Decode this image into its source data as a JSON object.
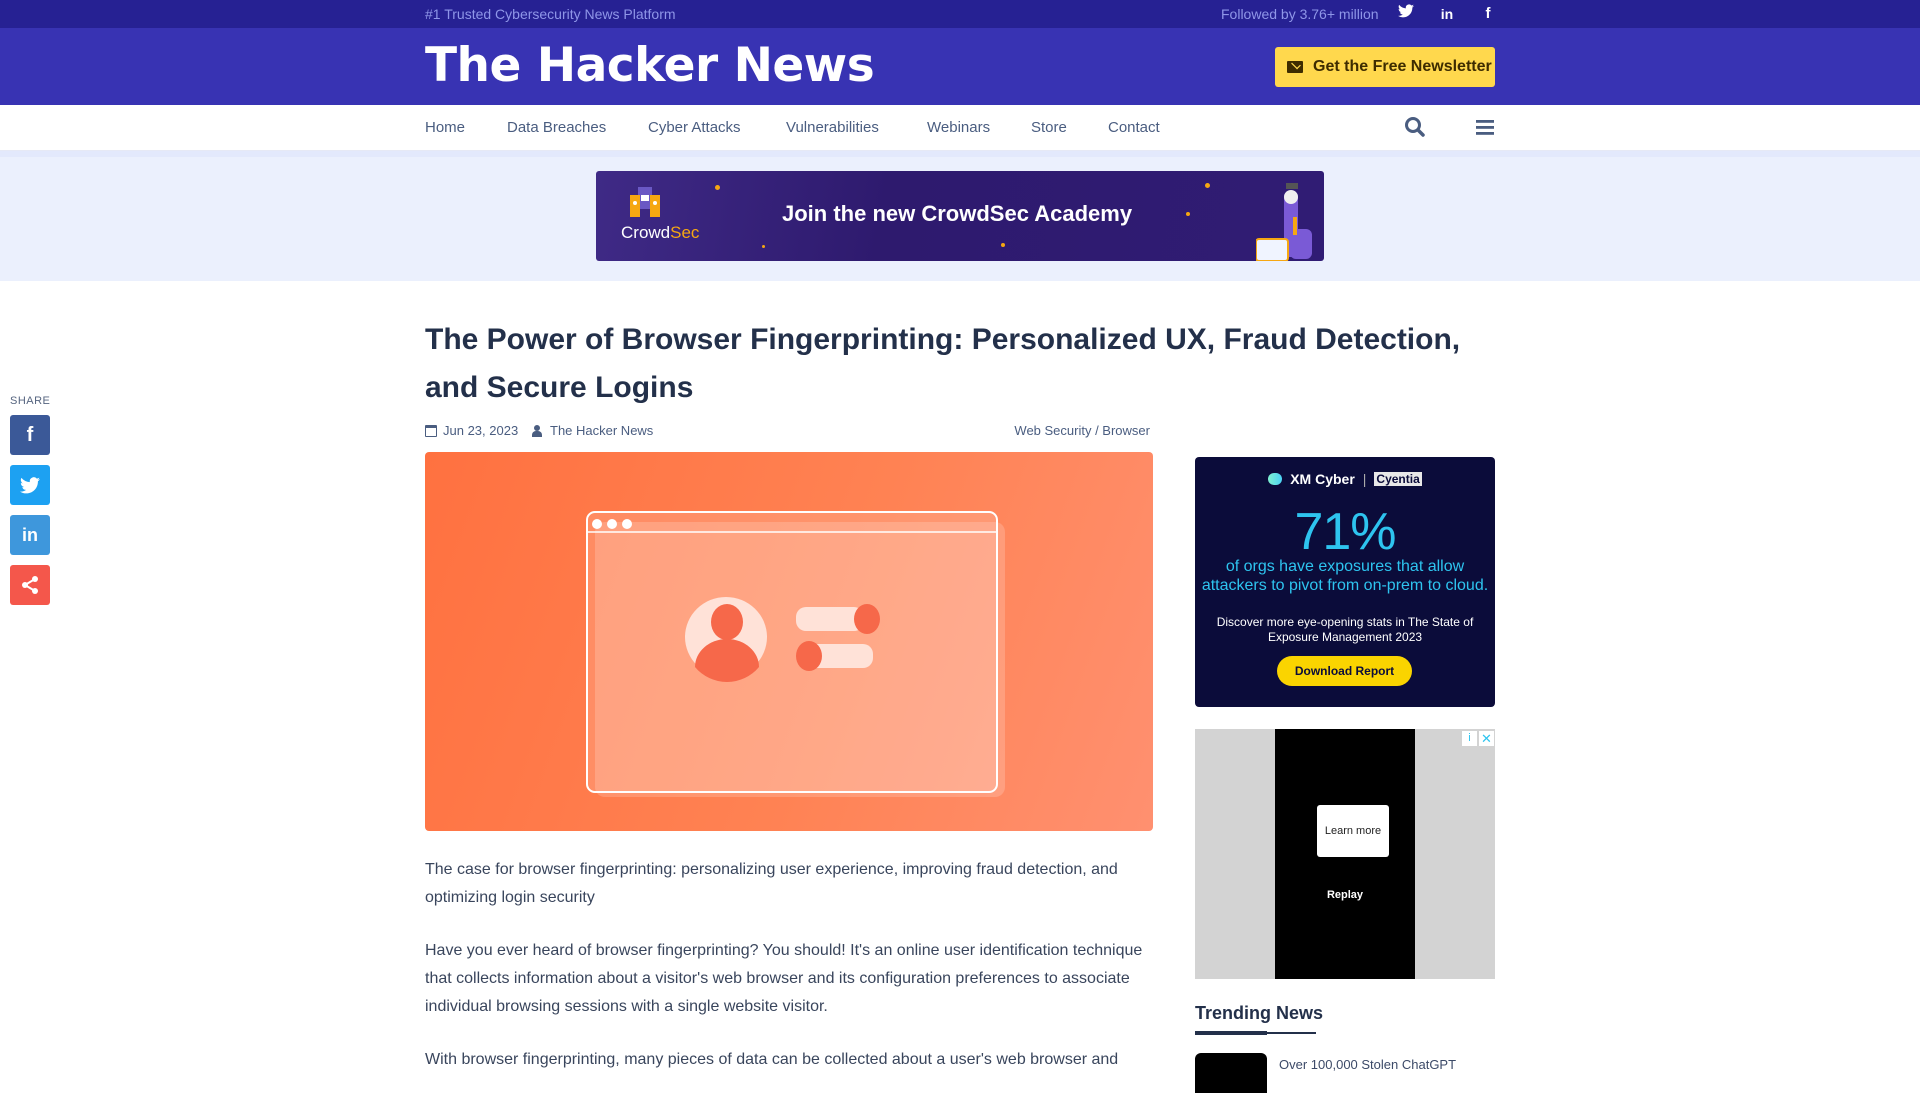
{
  "topbar": {
    "tagline": "#1 Trusted Cybersecurity News Platform",
    "followed": "Followed by 3.76+ million",
    "social": [
      {
        "name": "twitter",
        "glyph": "t"
      },
      {
        "name": "linkedin",
        "glyph": "in"
      },
      {
        "name": "facebook",
        "glyph": "f"
      }
    ]
  },
  "header": {
    "logo": "The Hacker News",
    "newsletter_label": "Get the Free Newsletter"
  },
  "nav": {
    "items": [
      "Home",
      "Data Breaches",
      "Cyber Attacks",
      "Vulnerabilities",
      "Webinars",
      "Store",
      "Contact"
    ],
    "search_icon": "search-icon",
    "menu_icon": "hamburger-menu-icon"
  },
  "banner_ad": {
    "headline": "Join the new CrowdSec Academy",
    "brand_a": "Crowd",
    "brand_b": "Sec"
  },
  "share": {
    "label": "SHARE",
    "buttons": [
      {
        "name": "facebook",
        "glyph": "f",
        "color": "#3b5998"
      },
      {
        "name": "twitter",
        "glyph": "t",
        "color": "#1da1f2"
      },
      {
        "name": "linkedin",
        "glyph": "in",
        "color": "#3e97dc"
      },
      {
        "name": "share",
        "glyph": "share",
        "color": "#f4574b"
      }
    ]
  },
  "article": {
    "title": "The Power of Browser Fingerprinting: Personalized UX, Fraud Detection, and Secure Logins",
    "date": "Jun 23, 2023",
    "author": "The Hacker News",
    "categories": "Web Security / Browser",
    "paragraphs": [
      "The case for browser fingerprinting: personalizing user experience, improving fraud detection, and optimizing login security",
      "Have you ever heard of browser fingerprinting? You should! It's an online user identification technique that collects information about a visitor's web browser and its configuration preferences to associate individual browsing sessions with a single website visitor.",
      "With browser fingerprinting, many pieces of data can be collected about a user's web browser and"
    ]
  },
  "sidebar": {
    "xm_ad": {
      "brand1": "XM Cyber",
      "brand2": "Cyentia",
      "stat": "71%",
      "claim": "of orgs have exposures that allow attackers to pivot from on-prem to cloud.",
      "sub": "Discover more eye-opening stats in The State of Exposure Management 2023",
      "cta": "Download Report"
    },
    "video_ad": {
      "learn_more": "Learn more",
      "replay": "Replay",
      "info": "i",
      "close": "✕"
    },
    "trending": {
      "heading": "Trending News",
      "items": [
        {
          "title": "Over 100,000 Stolen ChatGPT"
        }
      ]
    }
  },
  "colors": {
    "topbar": "#262193",
    "header": "#3833b3",
    "newsletter": "#ffd84d",
    "nav_text": "#4a5d80",
    "hero": "#ff7a4a"
  }
}
